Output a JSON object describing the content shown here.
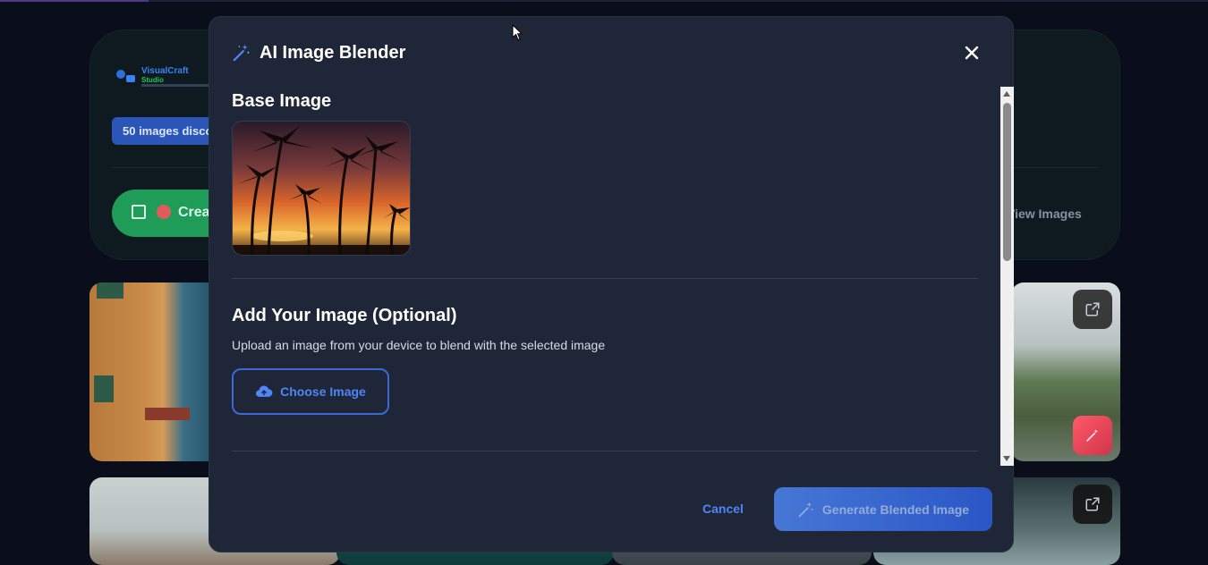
{
  "background": {
    "logo_name": "VisualCraft",
    "logo_sub": "Studio",
    "images_badge": "50 images discovered",
    "create_button": "Create",
    "view_images": "View Images"
  },
  "modal": {
    "title": "AI Image Blender",
    "base_section_title": "Base Image",
    "add_section_title": "Add Your Image (Optional)",
    "add_description": "Upload an image from your device to blend with the selected image",
    "choose_button": "Choose Image",
    "cancel_button": "Cancel",
    "generate_button": "Generate Blended Image"
  },
  "icons": {
    "title": "magic-wand-icon",
    "close": "close-icon",
    "upload": "cloud-upload-icon",
    "generate": "magic-wand-icon",
    "tile_open": "external-link-icon",
    "tile_magic": "magic-wand-icon"
  },
  "colors": {
    "modal_bg": "#1e2637",
    "accent_blue": "#4f86f7",
    "generate_gradient": [
      "#4d86f2",
      "#2d5fe0"
    ],
    "create_green": "#1f9c58"
  }
}
